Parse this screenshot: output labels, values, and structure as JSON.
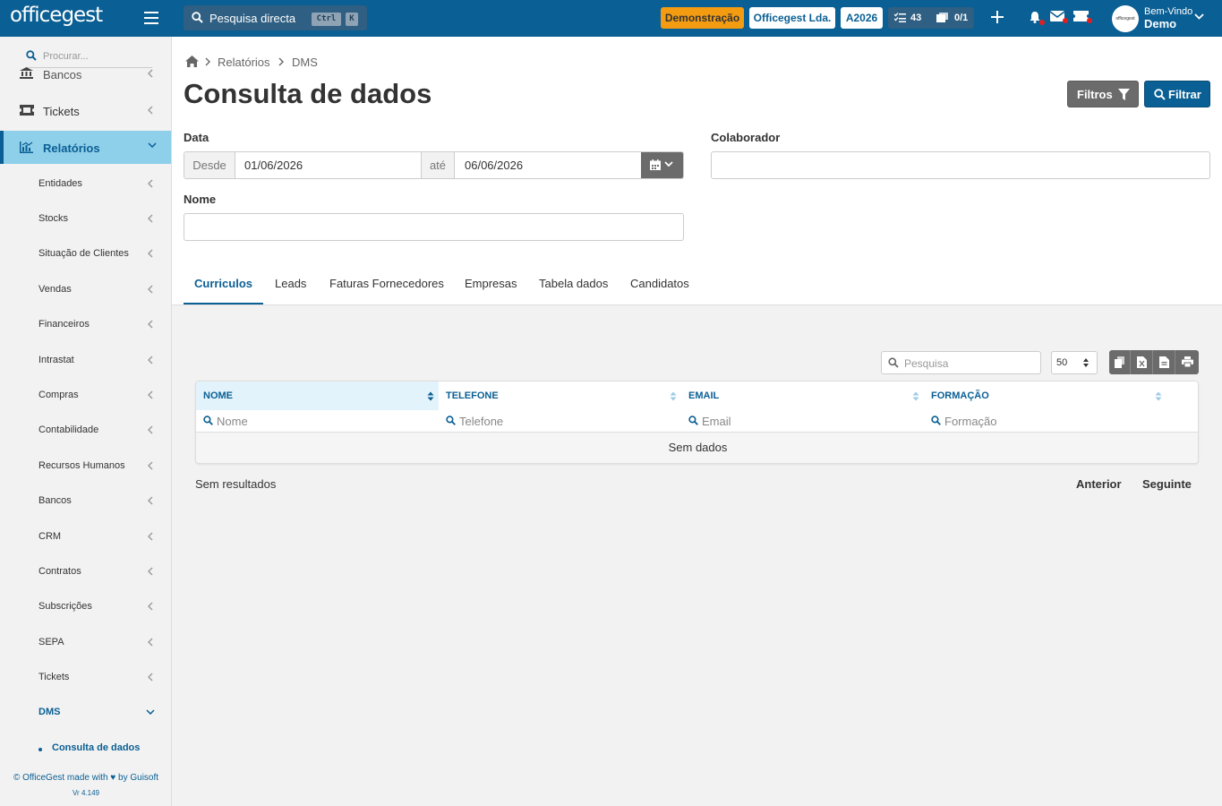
{
  "colors": {
    "primary": "#0a5f94",
    "demo_badge": "#f39c12",
    "active_menu": "#8ecfea",
    "button_dark": "#6b6b6b"
  },
  "topbar": {
    "logo": "officegest",
    "search_label": "Pesquisa directa",
    "kbd_ctrl": "Ctrl",
    "kbd_k": "K",
    "demo_badge": "Demonstração",
    "company_badge": "Officegest Lda.",
    "year_badge": "A2026",
    "tasks_count": "43",
    "docs_count": "0/1",
    "welcome": "Bem-Vindo",
    "user": "Demo",
    "avatar_text": "officegest"
  },
  "sidebar": {
    "search_placeholder": "Procurar...",
    "top_items": [
      {
        "label": "Bancos",
        "icon": "bank-icon"
      },
      {
        "label": "Tickets",
        "icon": "ticket-icon"
      },
      {
        "label": "Relatórios",
        "icon": "chart-icon"
      }
    ],
    "sub_items": [
      {
        "label": "Entidades"
      },
      {
        "label": "Stocks"
      },
      {
        "label": "Situação de Clientes"
      },
      {
        "label": "Vendas"
      },
      {
        "label": "Financeiros"
      },
      {
        "label": "Intrastat"
      },
      {
        "label": "Compras"
      },
      {
        "label": "Contabilidade"
      },
      {
        "label": "Recursos Humanos"
      },
      {
        "label": "Bancos"
      },
      {
        "label": "CRM"
      },
      {
        "label": "Contratos"
      },
      {
        "label": "Subscrições"
      },
      {
        "label": "SEPA"
      },
      {
        "label": "Tickets"
      },
      {
        "label": "DMS"
      }
    ],
    "active_leaf": "Consulta de dados",
    "footer_pre": "© OfficeGest made with",
    "footer_post": "by Guisoft",
    "version": "Vr 4.149"
  },
  "breadcrumb": {
    "items": [
      "Relatórios",
      "DMS"
    ]
  },
  "page": {
    "title": "Consulta de dados"
  },
  "buttons": {
    "filtros": "Filtros",
    "filtrar": "Filtrar"
  },
  "form": {
    "data_label": "Data",
    "desde": "Desde",
    "date_from": "01/06/2026",
    "ate": "até",
    "date_to": "06/06/2026",
    "colaborador_label": "Colaborador",
    "colaborador_value": "",
    "nome_label": "Nome",
    "nome_value": ""
  },
  "tabs": [
    "Curriculos",
    "Leads",
    "Faturas Fornecedores",
    "Empresas",
    "Tabela dados",
    "Candidatos"
  ],
  "table": {
    "search_placeholder": "Pesquisa",
    "page_size": "50",
    "columns": [
      {
        "header": "NOME",
        "filter": "Nome"
      },
      {
        "header": "TELEFONE",
        "filter": "Telefone"
      },
      {
        "header": "EMAIL",
        "filter": "Email"
      },
      {
        "header": "FORMAÇÃO",
        "filter": "Formação"
      }
    ],
    "empty": "Sem dados",
    "results": "Sem resultados",
    "prev": "Anterior",
    "next": "Seguinte"
  }
}
